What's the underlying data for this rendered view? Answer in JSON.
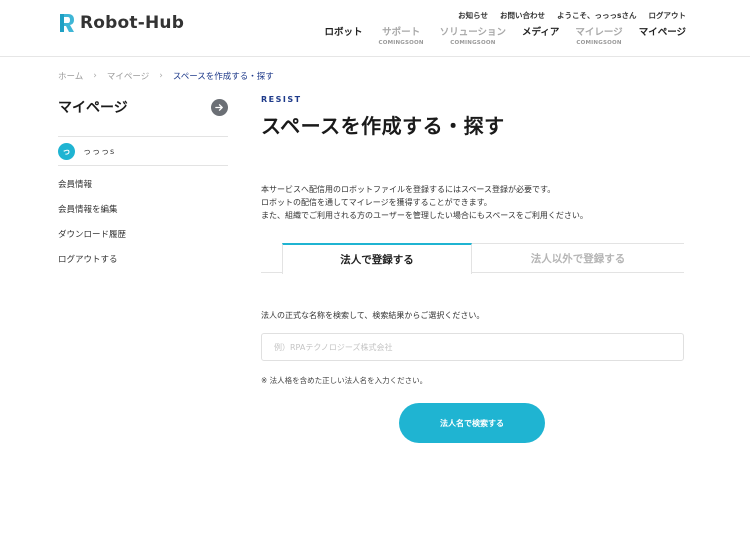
{
  "header": {
    "logo_text": "Robot-Hub",
    "top_links": [
      "お知らせ",
      "お問い合わせ",
      "ようこそ、っっっsさん",
      "ログアウト"
    ],
    "nav": [
      {
        "label": "ロボット",
        "sub": ""
      },
      {
        "label": "サポート",
        "sub": "COMINGSOON"
      },
      {
        "label": "ソリューション",
        "sub": "COMINGSOON"
      },
      {
        "label": "メディア",
        "sub": ""
      },
      {
        "label": "マイレージ",
        "sub": "COMINGSOON"
      },
      {
        "label": "マイページ",
        "sub": ""
      }
    ]
  },
  "breadcrumb": {
    "items": [
      "ホーム",
      "マイページ",
      "スペースを作成する・探す"
    ],
    "separator": "›"
  },
  "sidebar": {
    "title": "マイページ",
    "user_initial": "っ",
    "user_name": "っっっs",
    "menu": [
      "会員情報",
      "会員情報を編集",
      "ダウンロード履歴",
      "ログアウトする"
    ]
  },
  "main": {
    "eyebrow": "RESIST",
    "title": "スペースを作成する・探す",
    "intro": [
      "本サービスへ配信用のロボットファイルを登録するにはスペース登録が必要です。",
      "ロボットの配信を通してマイレージを獲得することができます。",
      "また、組織でご利用される方のユーザーを管理したい場合にもスペースをご利用ください。"
    ],
    "tabs": [
      "法人で登録する",
      "法人以外で登録する"
    ],
    "instruction": "法人の正式な名称を検索して、検索結果からご選択ください。",
    "search_placeholder": "例）RPAテクノロジーズ株式会社",
    "search_value": "",
    "note": "※ 法人格を含めた正しい法人名を入力ください。",
    "search_button": "法人名で検索する"
  },
  "colors": {
    "accent": "#1fb4d2",
    "brand_navy": "#1e3a8a",
    "arrow_button": "#6b6f75"
  }
}
